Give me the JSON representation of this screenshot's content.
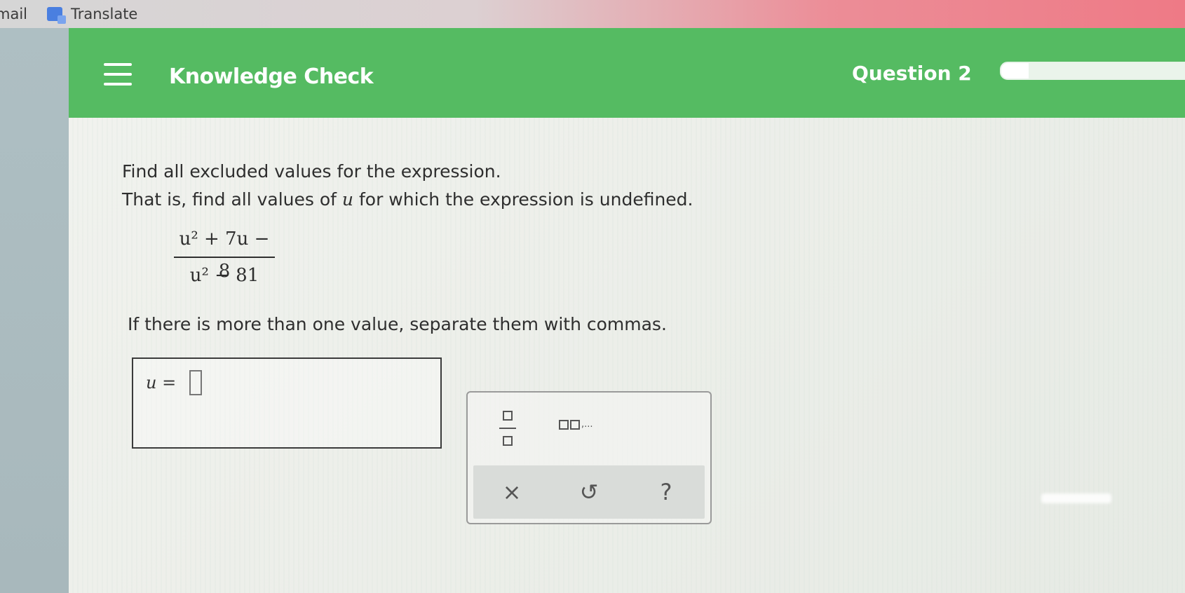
{
  "browser": {
    "bookmarks": [
      {
        "label": "mail"
      },
      {
        "label": "Translate",
        "icon": "translate-icon"
      }
    ]
  },
  "header": {
    "title": "Knowledge Check",
    "question_label": "Question 2",
    "progress_fraction": 0.13,
    "background_color": "#55bb62"
  },
  "question": {
    "line1": "Find all excluded values for the expression.",
    "line2_pre": "That is, find all values of ",
    "line2_var": "u",
    "line2_post": " for which the expression is undefined.",
    "numerator": "u² + 7u − 8",
    "denominator": "u² − 81",
    "instruction": "If there is more than one value, separate them with commas."
  },
  "answer": {
    "label": "u =",
    "value": ""
  },
  "tools": {
    "clear_symbol": "×",
    "undo_symbol": "↺",
    "help_symbol": "?",
    "list_suffix": ",..."
  }
}
